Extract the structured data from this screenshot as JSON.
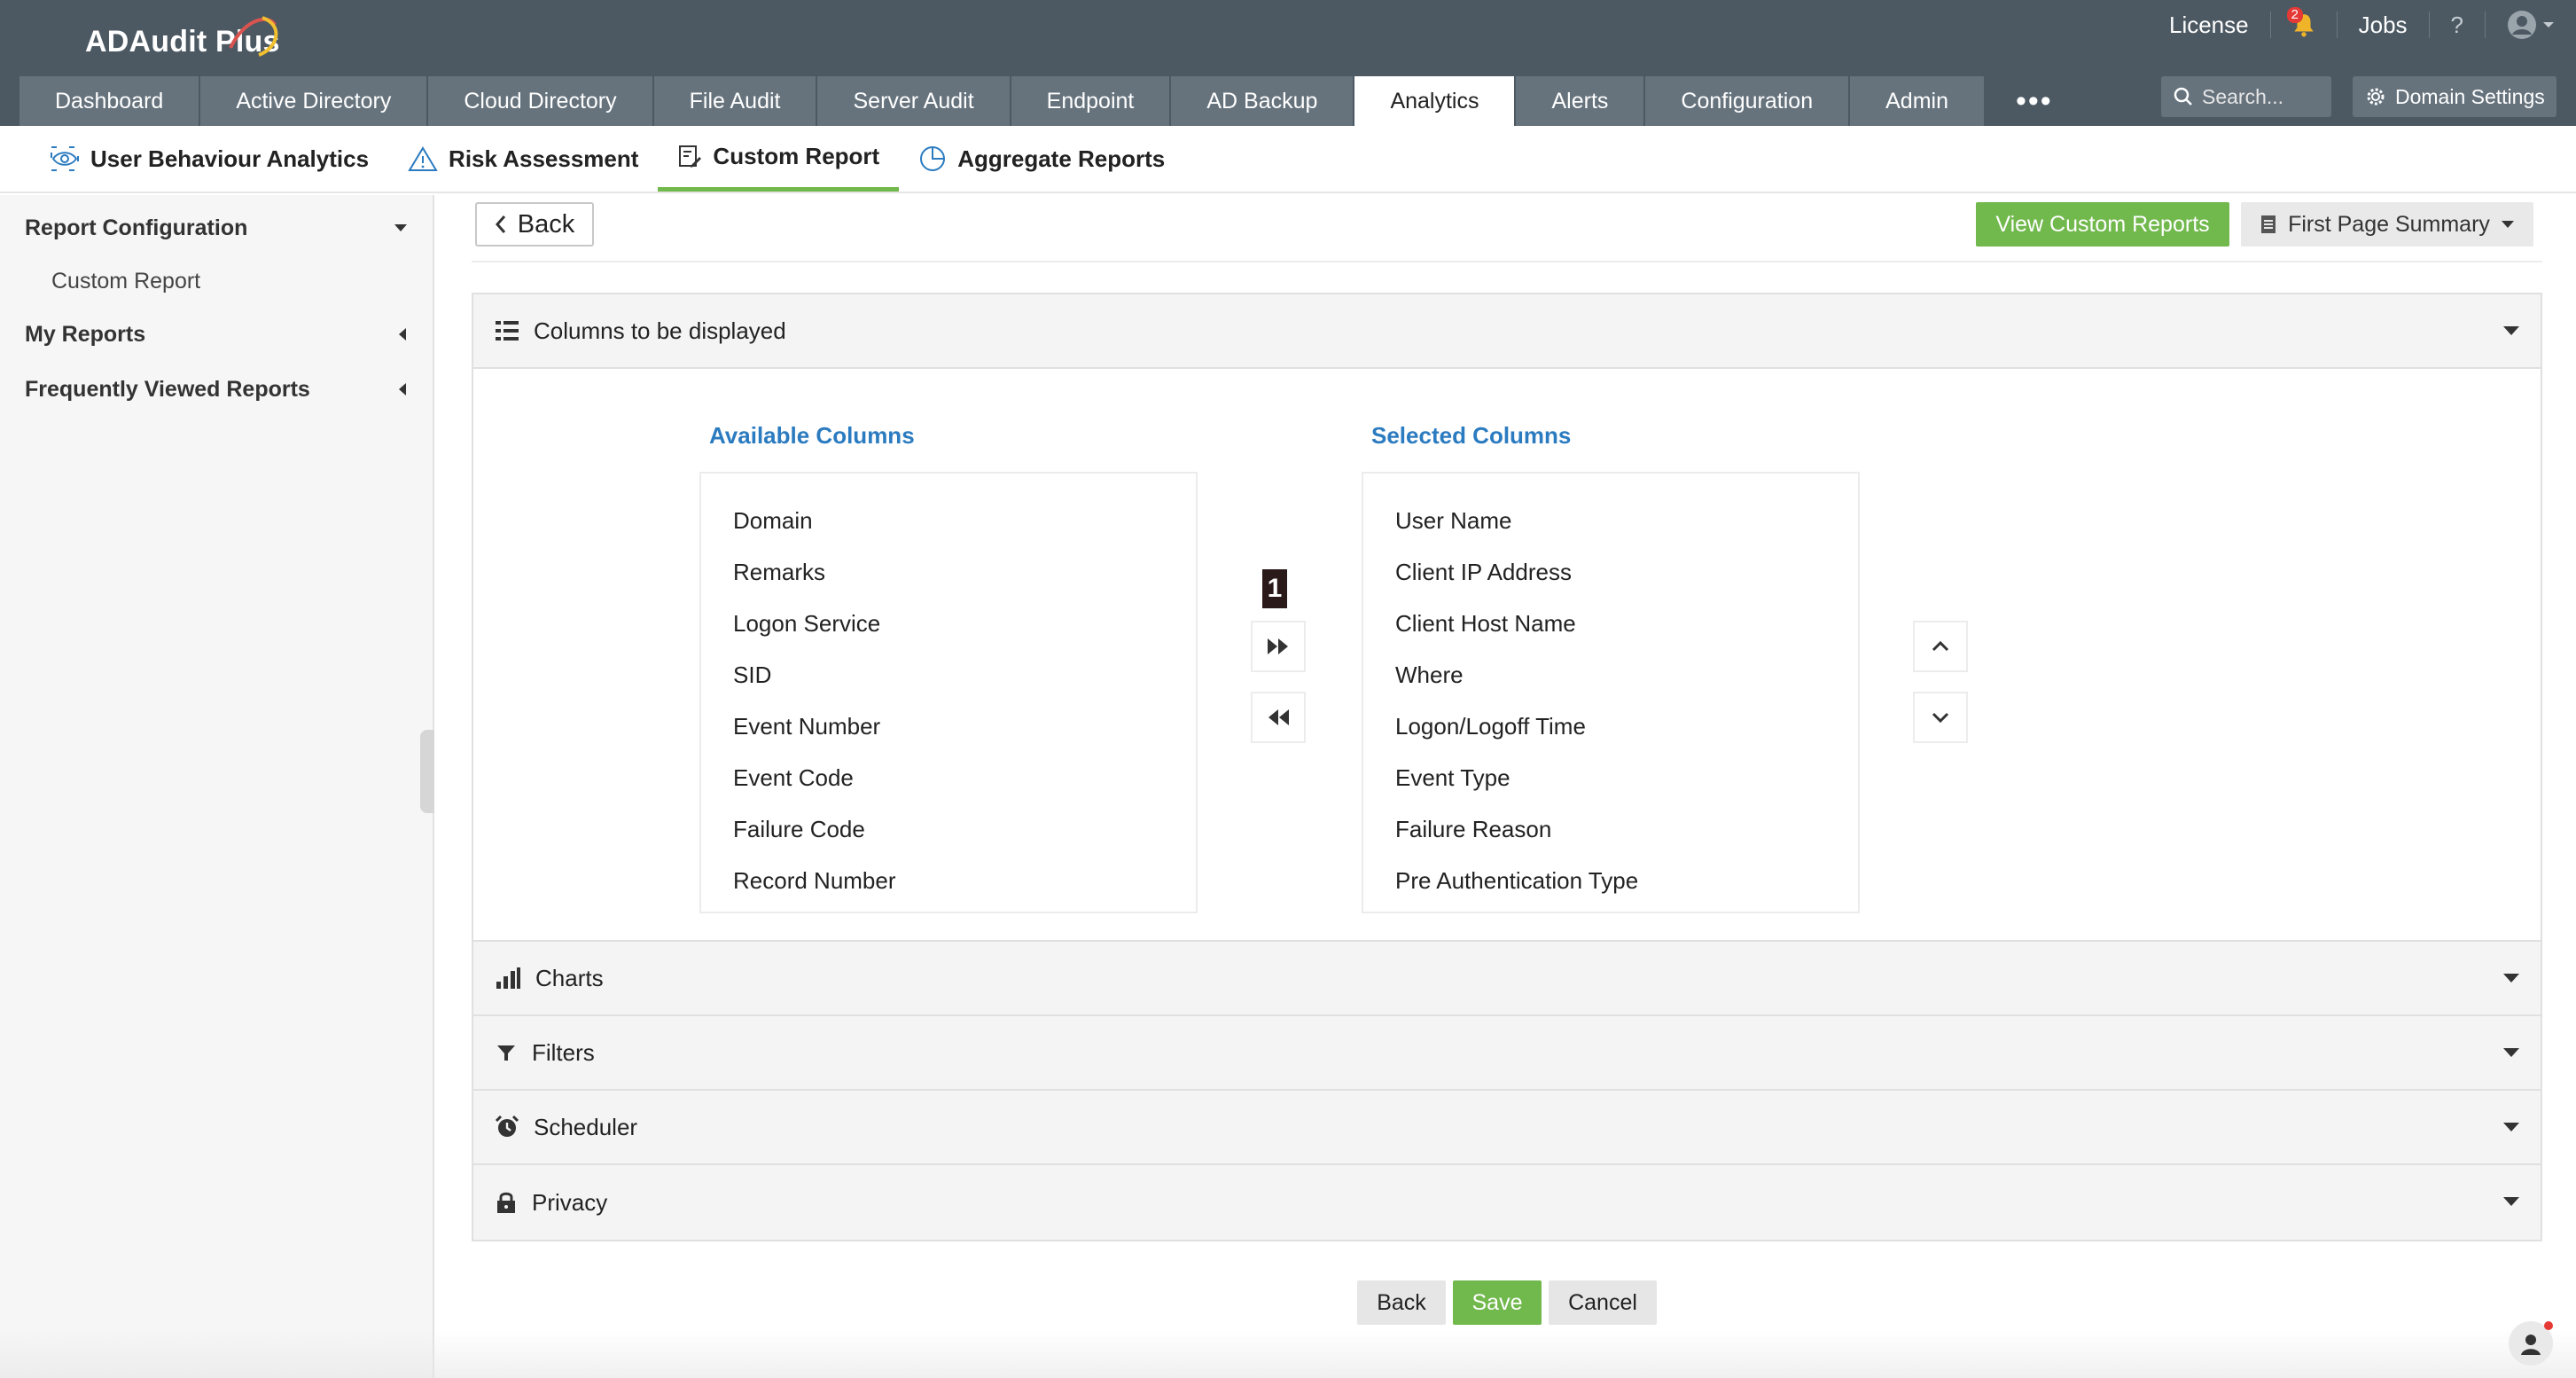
{
  "app": {
    "name": "ADAudit Plus"
  },
  "topbar": {
    "license": "License",
    "notifications_count": "2",
    "jobs": "Jobs",
    "help": "?"
  },
  "main_nav": {
    "tabs": [
      {
        "label": "Dashboard"
      },
      {
        "label": "Active Directory"
      },
      {
        "label": "Cloud Directory"
      },
      {
        "label": "File Audit"
      },
      {
        "label": "Server Audit"
      },
      {
        "label": "Endpoint"
      },
      {
        "label": "AD Backup"
      },
      {
        "label": "Analytics",
        "active": true
      },
      {
        "label": "Alerts"
      },
      {
        "label": "Configuration"
      },
      {
        "label": "Admin"
      }
    ],
    "more": "•••",
    "search_placeholder": "Search...",
    "domain_settings": "Domain Settings"
  },
  "sub_nav": {
    "tabs": [
      {
        "label": "User Behaviour Analytics",
        "icon": "eye-icon"
      },
      {
        "label": "Risk Assessment",
        "icon": "warning-icon"
      },
      {
        "label": "Custom Report",
        "icon": "report-edit-icon",
        "active": true
      },
      {
        "label": "Aggregate Reports",
        "icon": "pie-chart-icon"
      }
    ]
  },
  "sidebar": {
    "report_configuration": "Report Configuration",
    "custom_report": "Custom Report",
    "my_reports": "My Reports",
    "frequently_viewed": "Frequently Viewed Reports"
  },
  "toolbar": {
    "back": "Back",
    "view_custom_reports": "View Custom Reports",
    "first_page_summary": "First Page Summary"
  },
  "columns_section": {
    "title": "Columns to be displayed",
    "available_title": "Available Columns",
    "selected_title": "Selected Columns",
    "available": [
      "Domain",
      "Remarks",
      "Logon Service",
      "SID",
      "Event Number",
      "Event Code",
      "Failure Code",
      "Record Number"
    ],
    "selected": [
      "User Name",
      "Client IP Address",
      "Client Host Name",
      "Where",
      "Logon/Logoff Time",
      "Event Type",
      "Failure Reason",
      "Pre Authentication Type"
    ],
    "marker": "1"
  },
  "sections": {
    "charts": "Charts",
    "filters": "Filters",
    "scheduler": "Scheduler",
    "privacy": "Privacy"
  },
  "footer": {
    "back": "Back",
    "save": "Save",
    "cancel": "Cancel"
  },
  "colors": {
    "header_bg": "#4c5963",
    "nav_tab_bg": "#66737d",
    "accent_green": "#71b84d",
    "link_blue": "#2b7bc0"
  }
}
